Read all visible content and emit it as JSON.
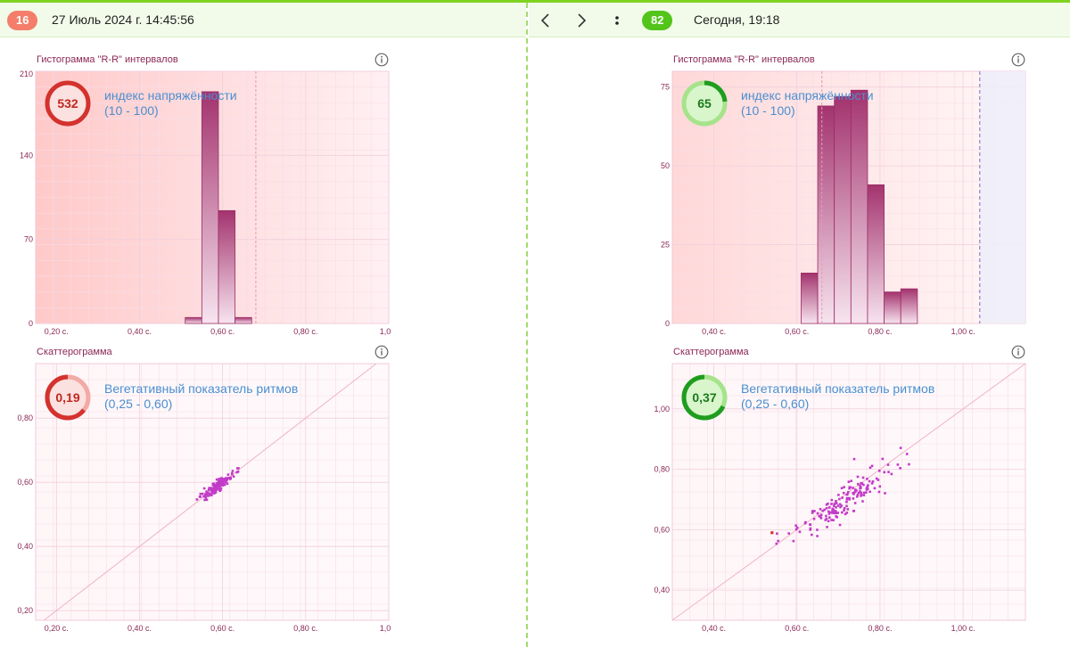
{
  "left": {
    "badge": "16",
    "datetime": "27 Июль 2024 г. 14:45:56",
    "histogram": {
      "title": "Гистограмма \"R-R\" интервалов",
      "gauge_value": "532",
      "gauge_label": "индекс напряжённости",
      "gauge_range": "(10 - 100)"
    },
    "scatter": {
      "title": "Скаттерограмма",
      "gauge_value": "0,19",
      "gauge_label": "Вегетативный показатель ритмов",
      "gauge_range": "(0,25 - 0,60)"
    }
  },
  "right": {
    "badge": "82",
    "datetime": "Сегодня, 19:18",
    "histogram": {
      "title": "Гистограмма \"R-R\" интервалов",
      "gauge_value": "65",
      "gauge_label": "индекс напряжённости",
      "gauge_range": "(10 - 100)"
    },
    "scatter": {
      "title": "Скаттерограмма",
      "gauge_value": "0,37",
      "gauge_label": "Вегетативный показатель ритмов",
      "gauge_range": "(0,25 - 0,60)"
    }
  },
  "nav": {
    "prev_icon": "chevron-left-icon",
    "next_icon": "chevron-right-icon",
    "more_icon": "more-vertical-icon"
  },
  "colors": {
    "accent_green": "#7ed321",
    "badge_red": "#f47e6b",
    "badge_green": "#52c41a",
    "bar_dark": "#a3336e",
    "point": "#c23bc8",
    "red_ring": "#d3322d",
    "green_ring": "#1f9d1f"
  },
  "chart_data": [
    {
      "type": "bar",
      "panel": "left-histogram",
      "x_unit": "с.",
      "xlim": [
        0.15,
        1.0
      ],
      "ylim": [
        0,
        210
      ],
      "xticks": [
        "0,20 с.",
        "0,40 с.",
        "0,60 с.",
        "0,80 с.",
        "1,0"
      ],
      "yticks": [
        "0",
        "70",
        "140",
        "210"
      ],
      "bin_width": 0.04,
      "bins": [
        {
          "x": 0.53,
          "y": 5
        },
        {
          "x": 0.57,
          "y": 193
        },
        {
          "x": 0.61,
          "y": 94
        },
        {
          "x": 0.65,
          "y": 5
        }
      ],
      "marker_x": 0.68
    },
    {
      "type": "bar",
      "panel": "right-histogram",
      "x_unit": "с.",
      "xlim": [
        0.3,
        1.15
      ],
      "ylim": [
        0,
        80
      ],
      "xticks": [
        "0,40 с.",
        "0,60 с.",
        "0,80 с.",
        "1,00 с."
      ],
      "yticks": [
        "0",
        "25",
        "50",
        "75"
      ],
      "bin_width": 0.04,
      "bins": [
        {
          "x": 0.63,
          "y": 16
        },
        {
          "x": 0.67,
          "y": 69
        },
        {
          "x": 0.71,
          "y": 72
        },
        {
          "x": 0.75,
          "y": 74
        },
        {
          "x": 0.79,
          "y": 44
        },
        {
          "x": 0.83,
          "y": 10
        },
        {
          "x": 0.87,
          "y": 11
        }
      ],
      "marker_x": 0.66,
      "dashed_x": 1.04
    },
    {
      "type": "scatter",
      "panel": "left-scatter",
      "xlim": [
        0.15,
        1.0
      ],
      "ylim": [
        0.17,
        0.97
      ],
      "xticks": [
        "0,20 с.",
        "0,40 с.",
        "0,60 с.",
        "0,80 с.",
        "1,0"
      ],
      "yticks": [
        "0,20",
        "0,40",
        "0,60",
        "0,80"
      ],
      "cloud": {
        "cx": 0.59,
        "cy": 0.59,
        "sd": 0.018,
        "count": 150
      }
    },
    {
      "type": "scatter",
      "panel": "right-scatter",
      "xlim": [
        0.3,
        1.15
      ],
      "ylim": [
        0.3,
        1.15
      ],
      "xticks": [
        "0,40 с.",
        "0,60 с.",
        "0,80 с.",
        "1,00 с."
      ],
      "yticks": [
        "0,40",
        "0,60",
        "0,80",
        "1,00"
      ],
      "cloud": {
        "cx": 0.72,
        "cy": 0.7,
        "sd": 0.055,
        "count": 160
      },
      "outlier": {
        "x": 0.54,
        "y": 0.59
      }
    }
  ]
}
